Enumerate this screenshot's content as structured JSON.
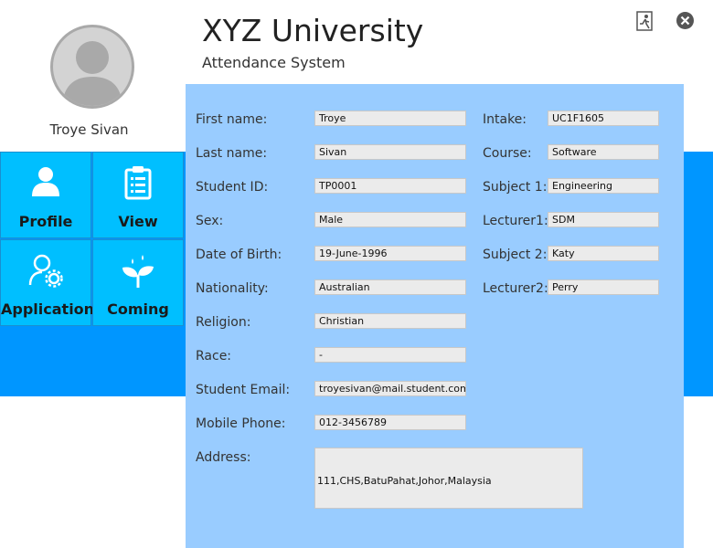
{
  "app": {
    "title": "XYZ University",
    "subtitle": "Attendance System"
  },
  "user": {
    "name": "Troye Sivan"
  },
  "nav": {
    "tiles": [
      {
        "label": "Profile",
        "icon": "user-icon"
      },
      {
        "label": "View",
        "icon": "clipboard-icon"
      },
      {
        "label": "Application",
        "icon": "user-settings-icon"
      },
      {
        "label": "Coming",
        "icon": "sprout-icon"
      }
    ]
  },
  "window": {
    "icons": [
      "exit-icon",
      "close-icon"
    ]
  },
  "form": {
    "left": [
      {
        "label": "First name:",
        "value": "Troye"
      },
      {
        "label": "Last name:",
        "value": "Sivan"
      },
      {
        "label": "Student ID:",
        "value": "TP0001"
      },
      {
        "label": "Sex:",
        "value": "Male"
      },
      {
        "label": "Date of Birth:",
        "value": "19-June-1996"
      },
      {
        "label": "Nationality:",
        "value": "Australian"
      },
      {
        "label": "Religion:",
        "value": "Christian"
      },
      {
        "label": "Race:",
        "value": "-"
      },
      {
        "label": "Student Email:",
        "value": "troyesivan@mail.student.com"
      },
      {
        "label": "Mobile Phone:",
        "value": "012-3456789"
      }
    ],
    "right": [
      {
        "label": "Intake:",
        "value": "UC1F1605"
      },
      {
        "label": "Course:",
        "value": "Software"
      },
      {
        "label": "Subject 1:",
        "value": "Engineering"
      },
      {
        "label": "Lecturer1:",
        "value": "SDM"
      },
      {
        "label": "Subject 2:",
        "value": "Katy"
      },
      {
        "label": "Lecturer2:",
        "value": "Perry"
      }
    ],
    "address": {
      "label": "Address:",
      "value": "111,CHS,BatuPahat,Johor,Malaysia"
    }
  },
  "colors": {
    "band": "#0096ff",
    "panel": "#99ccff",
    "tile": "#00bfff",
    "field": "#ebebeb"
  }
}
